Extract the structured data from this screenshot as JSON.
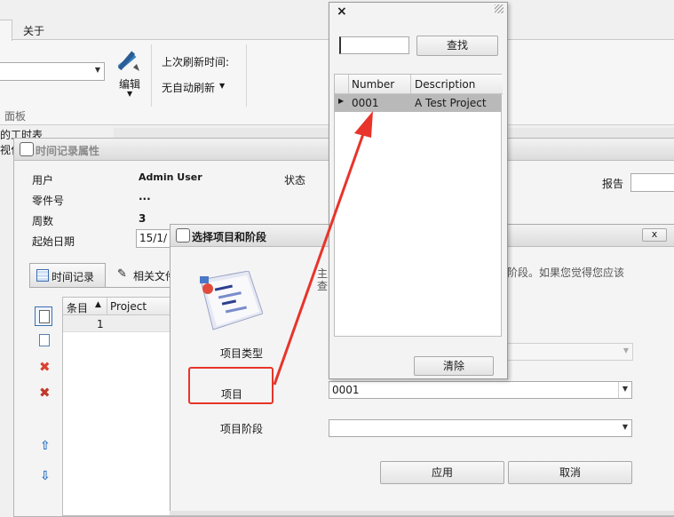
{
  "ribbon": {
    "tab_about": "关于",
    "edit_label": "编辑",
    "last_refresh_label": "上次刷新时间:",
    "auto_refresh_label": "无自动刷新",
    "panel_group_label": "面板",
    "edge_text_1": "的工时表",
    "edge_text_2": "视化"
  },
  "properties_window": {
    "title": "时间记录属性",
    "user_label": "用户",
    "user_value": "Admin User",
    "status_label": "状态",
    "part_label": "零件号",
    "part_value": "...",
    "week_label": "周数",
    "week_value": "3",
    "start_date_label": "起始日期",
    "start_date_value": "15/1/",
    "report_label": "报告",
    "tab_time": "时间记录",
    "tab_docs": "相关文件",
    "grid_col_item": "条目",
    "grid_col_project": "Project",
    "grid_row_num": "1"
  },
  "select_dialog": {
    "title": "选择项目和阶段",
    "desc_left": "主",
    "desc_left2": "查",
    "desc_right": "阶段。如果您觉得您应该",
    "project_type_label": "项目类型",
    "project_label": "项目",
    "project_value": "0001",
    "phase_label": "项目阶段",
    "ok_label": "应用",
    "cancel_label": "取消",
    "close_label": "x"
  },
  "lookup_popup": {
    "close_label": "×",
    "search_value": "",
    "search_button": "查找",
    "col_number": "Number",
    "col_description": "Description",
    "rows": [
      {
        "number": "0001",
        "description": "A Test Project"
      }
    ],
    "clear_button": "清除"
  },
  "colors": {
    "annotation_red": "#e8342a",
    "selected_row": "#b9b9b9"
  }
}
